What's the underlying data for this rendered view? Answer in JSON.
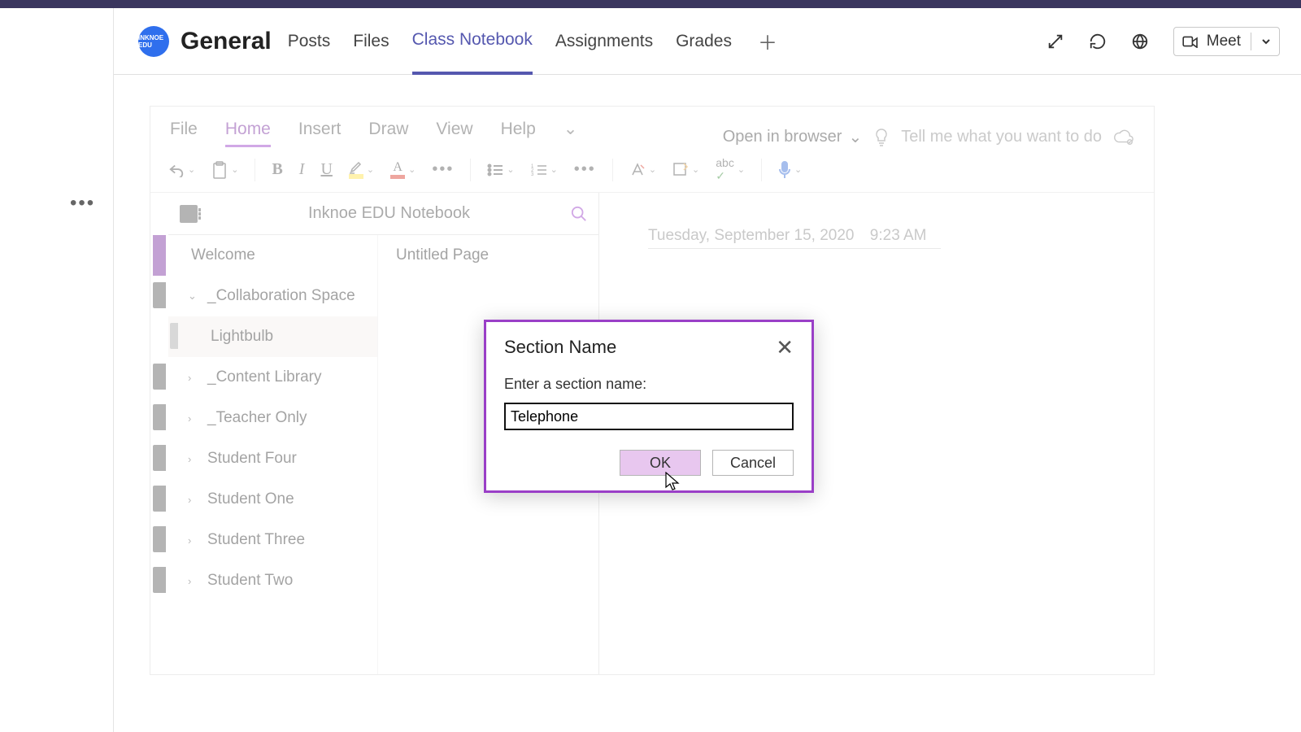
{
  "team": {
    "logo_text": "INKNOE EDU",
    "channel": "General"
  },
  "tabs": {
    "items": [
      "Posts",
      "Files",
      "Class Notebook",
      "Assignments",
      "Grades"
    ],
    "active_index": 2
  },
  "meet_label": "Meet",
  "ribbon": {
    "tabs": [
      "File",
      "Home",
      "Insert",
      "Draw",
      "View",
      "Help"
    ],
    "open_in_browser": "Open in browser",
    "tell_me": "Tell me what you want to do"
  },
  "notebook": {
    "title": "Inknoe EDU Notebook",
    "sections": [
      {
        "label": "Welcome",
        "kind": "welcome"
      },
      {
        "label": "_Collaboration Space",
        "expanded": true
      },
      {
        "label": "Lightbulb",
        "kind": "sub"
      },
      {
        "label": "_Content Library",
        "expanded": false
      },
      {
        "label": "_Teacher Only",
        "expanded": false
      },
      {
        "label": "Student Four",
        "expanded": false
      },
      {
        "label": "Student One",
        "expanded": false
      },
      {
        "label": "Student Three",
        "expanded": false
      },
      {
        "label": "Student Two",
        "expanded": false
      }
    ],
    "pages": [
      "Untitled Page"
    ],
    "page_date": "Tuesday, September 15, 2020",
    "page_time": "9:23 AM"
  },
  "dialog": {
    "title": "Section Name",
    "label": "Enter a section name:",
    "value": "Telephone",
    "ok": "OK",
    "cancel": "Cancel"
  }
}
